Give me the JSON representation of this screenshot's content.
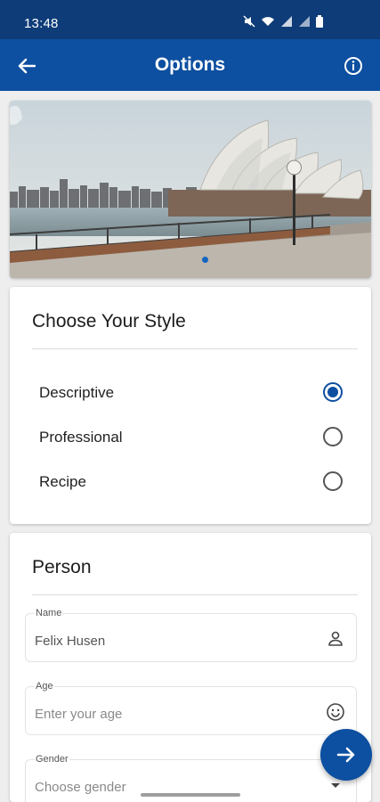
{
  "status_bar": {
    "time": "13:48"
  },
  "app_bar": {
    "title": "Options"
  },
  "hero": {
    "icon": "sydney-opera-house-photo"
  },
  "style_card": {
    "title": "Choose Your Style",
    "options": [
      {
        "label": "Descriptive",
        "selected": true
      },
      {
        "label": "Professional",
        "selected": false
      },
      {
        "label": "Recipe",
        "selected": false
      }
    ]
  },
  "person_card": {
    "title": "Person",
    "name_field": {
      "label": "Name",
      "value": "Felix Husen"
    },
    "age_field": {
      "label": "Age",
      "placeholder": "Enter your age"
    },
    "gender_field": {
      "label": "Gender",
      "placeholder": "Choose gender"
    }
  },
  "colors": {
    "primary": "#0d4fa0",
    "status_bar": "#0d3c78",
    "background": "#eeeeee"
  }
}
